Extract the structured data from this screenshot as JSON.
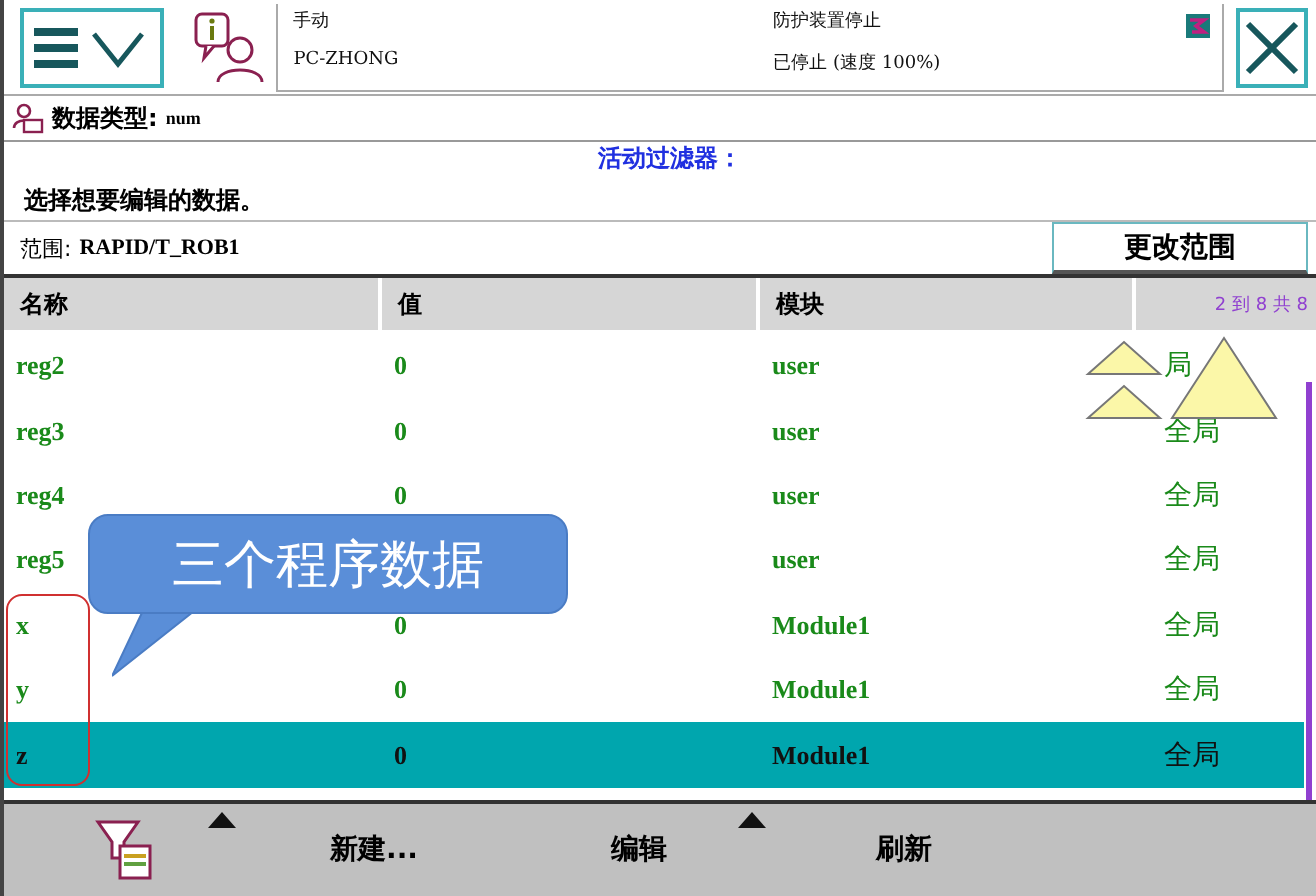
{
  "status": {
    "mode": "手动",
    "controller": "PC-ZHONG",
    "state": "防护装置停止",
    "run_state": "已停止 (速度 100%)"
  },
  "data_type": {
    "label": "数据类型:",
    "value": "num"
  },
  "instruction": "选择想要编辑的数据。",
  "filter_label": "活动过滤器：",
  "scope": {
    "label": "范围:",
    "value": "RAPID/T_ROB1"
  },
  "change_scope_button": "更改范围",
  "table": {
    "columns": [
      "名称",
      "值",
      "模块"
    ],
    "range": "2 到 8 共 8",
    "rows": [
      {
        "cells": [
          "reg2",
          "0",
          "user",
          "局"
        ],
        "selected": false
      },
      {
        "cells": [
          "reg3",
          "0",
          "user",
          "全局"
        ],
        "selected": false
      },
      {
        "cells": [
          "reg4",
          "0",
          "user",
          "全局"
        ],
        "selected": false
      },
      {
        "cells": [
          "reg5",
          null,
          "user",
          "全局"
        ],
        "selected": false
      },
      {
        "cells": [
          "x",
          "0",
          "Module1",
          "全局"
        ],
        "selected": false
      },
      {
        "cells": [
          "y",
          "0",
          "Module1",
          "全局"
        ],
        "selected": false
      },
      {
        "cells": [
          "z",
          "0",
          "Module1",
          "全局"
        ],
        "selected": true
      }
    ]
  },
  "callout": {
    "text": "三个程序数据"
  },
  "toolbar": [
    {
      "kind": "icon",
      "menu": true
    },
    {
      "kind": "text",
      "label": "新建...",
      "menu": false
    },
    {
      "kind": "text",
      "label": "编辑",
      "menu": true
    },
    {
      "kind": "text",
      "label": "刷新",
      "menu": false
    }
  ]
}
